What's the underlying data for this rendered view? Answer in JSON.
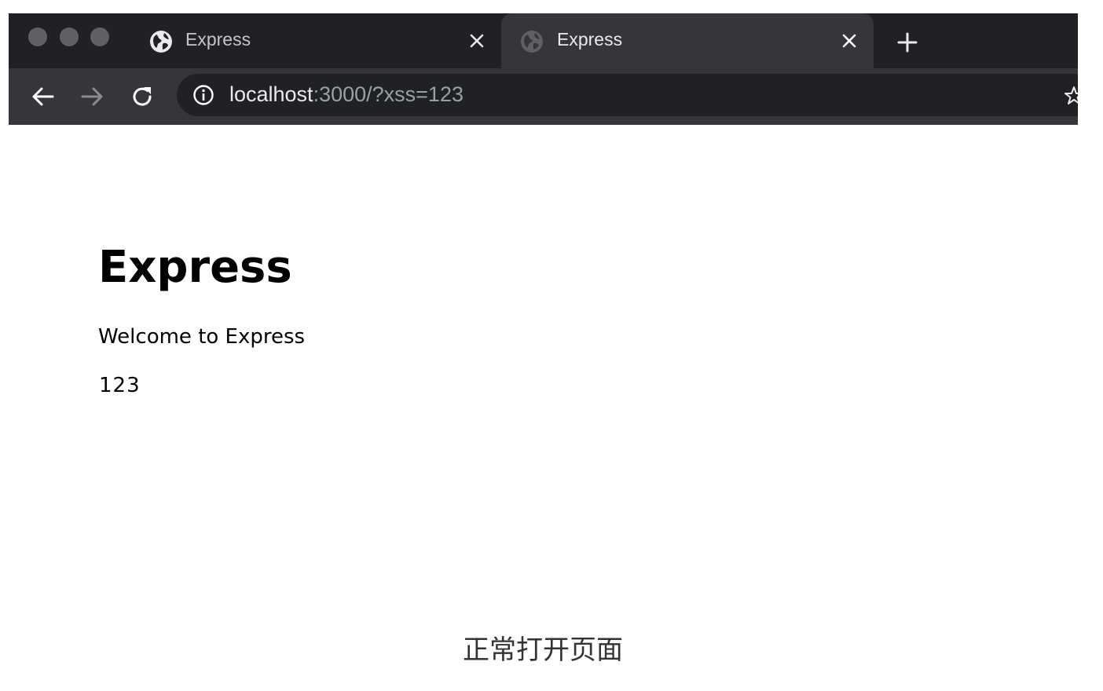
{
  "browser": {
    "tabs": [
      {
        "title": "Express",
        "icon": "globe-icon",
        "active": false
      },
      {
        "title": "Express",
        "icon": "globe-icon",
        "active": true
      }
    ],
    "address_bar": {
      "host": "localhost",
      "path": ":3000/?xss=123"
    }
  },
  "page": {
    "heading": "Express",
    "welcome": "Welcome to Express",
    "value": "123"
  },
  "caption": "正常打开页面",
  "colors": {
    "tab_strip": "#202124",
    "active_tab": "#35363a",
    "omnibox": "#202124",
    "text_light": "#e8eaed",
    "text_dim": "#9aa0a6"
  }
}
